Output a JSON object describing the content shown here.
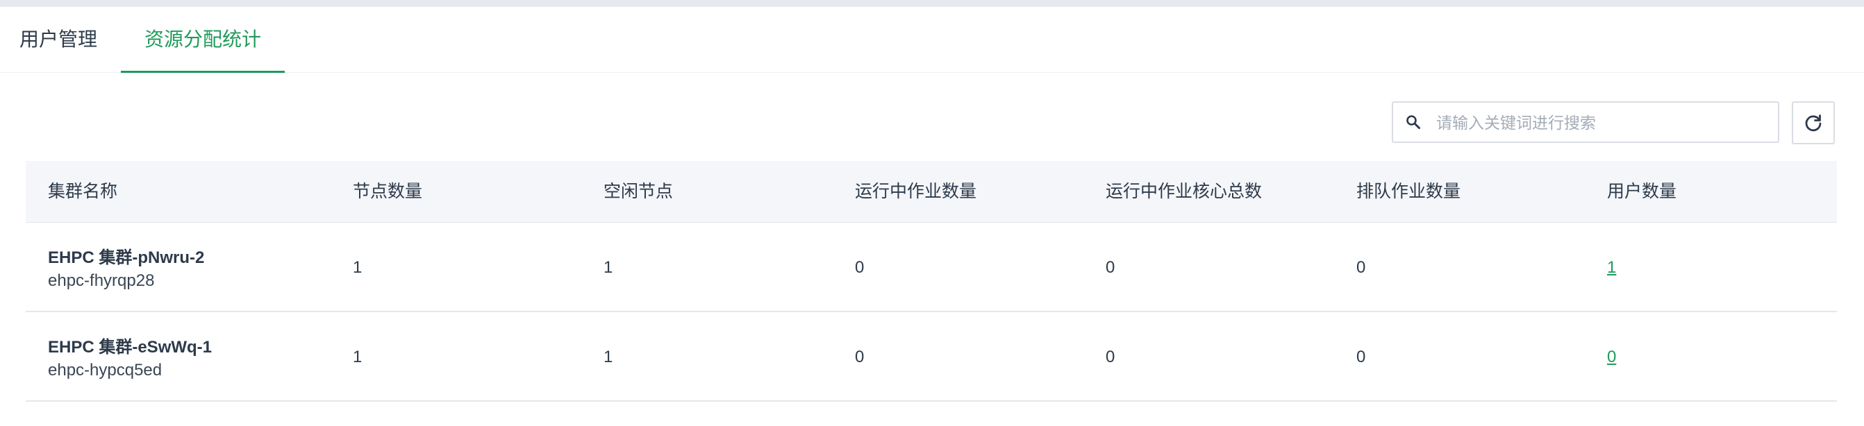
{
  "tabs": [
    {
      "label": "用户管理",
      "active": false
    },
    {
      "label": "资源分配统计",
      "active": true
    }
  ],
  "search": {
    "placeholder": "请输入关键词进行搜索",
    "value": ""
  },
  "icons": {
    "search": "search-icon",
    "refresh": "refresh-icon"
  },
  "colors": {
    "accent": "#1f9a5a",
    "header_bg": "#f4f6f9",
    "text": "#2d3a4a"
  },
  "table": {
    "columns": [
      "集群名称",
      "节点数量",
      "空闲节点",
      "运行中作业数量",
      "运行中作业核心总数",
      "排队作业数量",
      "用户数量"
    ],
    "rows": [
      {
        "name": "EHPC 集群-pNwru-2",
        "id": "ehpc-fhyrqp28",
        "nodes": "1",
        "idle_nodes": "1",
        "running_jobs": "0",
        "running_cores": "0",
        "queued_jobs": "0",
        "users": "1"
      },
      {
        "name": "EHPC 集群-eSwWq-1",
        "id": "ehpc-hypcq5ed",
        "nodes": "1",
        "idle_nodes": "1",
        "running_jobs": "0",
        "running_cores": "0",
        "queued_jobs": "0",
        "users": "0"
      }
    ]
  }
}
